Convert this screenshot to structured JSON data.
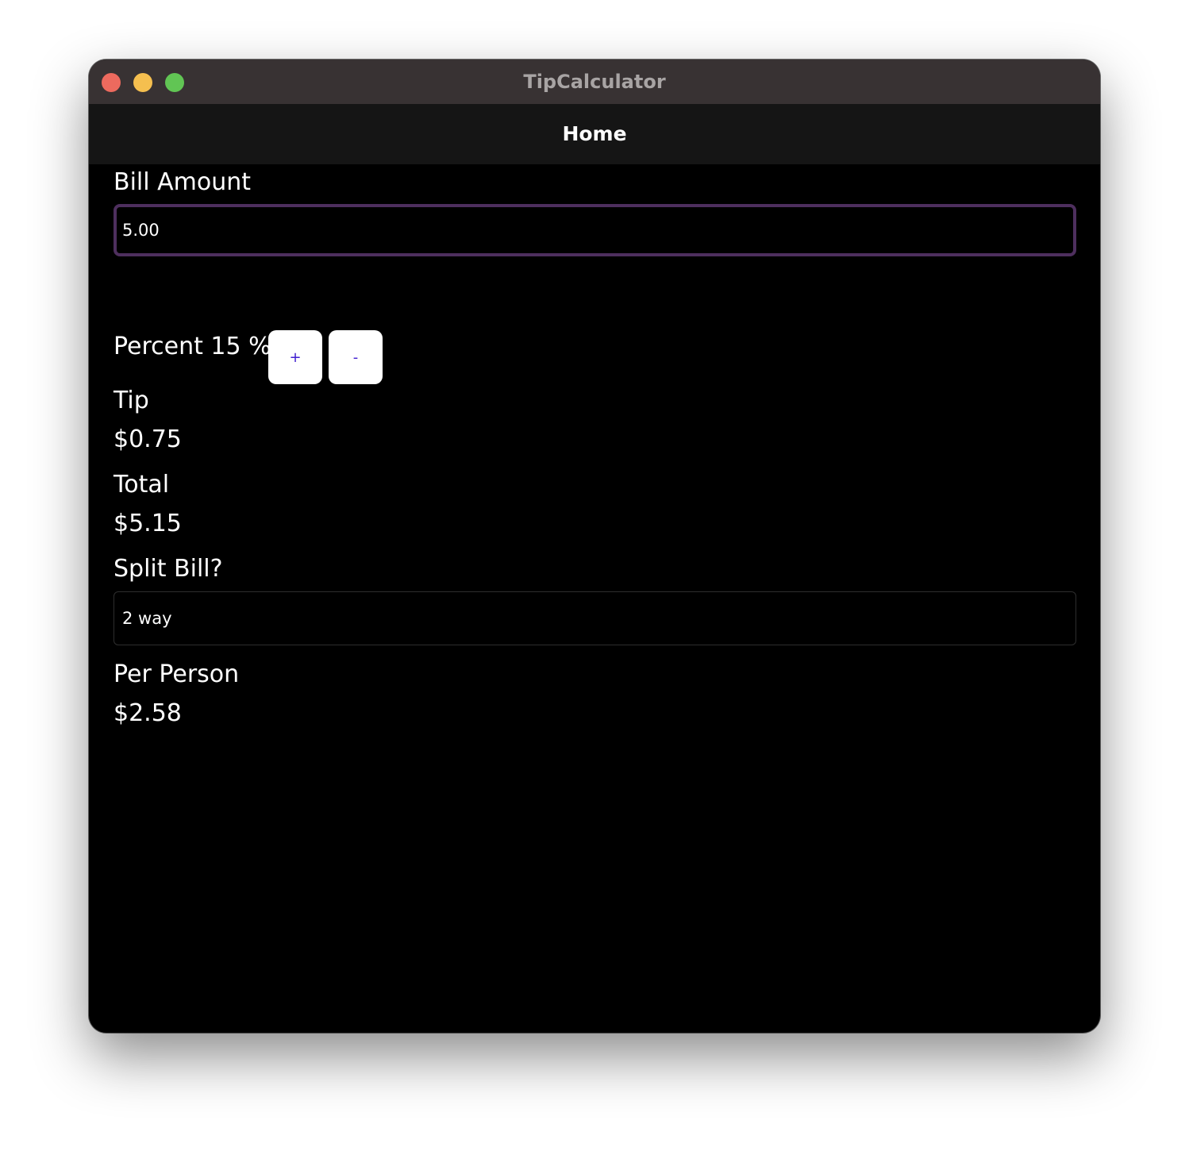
{
  "window": {
    "title": "TipCalculator"
  },
  "navbar": {
    "title": "Home"
  },
  "bill": {
    "label": "Bill Amount",
    "value": "5.00"
  },
  "percent": {
    "label": "Percent 15 %",
    "increment_label": "+",
    "decrement_label": "-"
  },
  "tip": {
    "label": "Tip",
    "value": "$0.75"
  },
  "total": {
    "label": "Total",
    "value": "$5.15"
  },
  "split": {
    "label": "Split Bill?",
    "selected": "2 way"
  },
  "per_person": {
    "label": "Per Person",
    "value": "$2.58"
  },
  "colors": {
    "titlebar": "#383233",
    "navbar": "#151515",
    "background": "#000000",
    "input_border": "#4e2f5e",
    "button_text": "#3f1ed0",
    "traffic_close": "#ed6a5e",
    "traffic_minimize": "#f5bf4f",
    "traffic_zoom": "#61c554"
  }
}
